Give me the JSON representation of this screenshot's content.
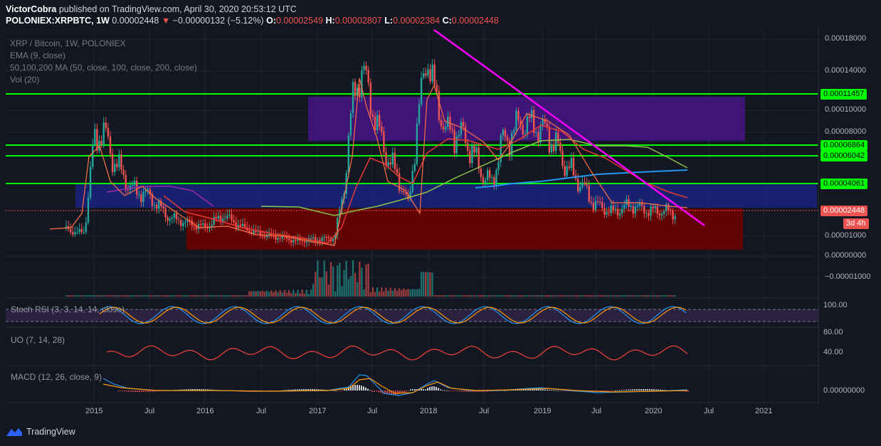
{
  "header": {
    "publisher": "VictorCobra",
    "published_text": "published on TradingView.com, April 30, 2020 20:53:12 UTC",
    "symbol": "POLONIEX:XRPBTC, 1W",
    "last": "0.00002448",
    "arrow": "▼",
    "change": "−0.00000132 (−5.12%)",
    "o_label": "O:",
    "o_value": "0.00002549",
    "h_label": "H:",
    "h_value": "0.00002807",
    "l_label": "L:",
    "l_value": "0.00002384",
    "c_label": "C:",
    "c_value": "0.00002448"
  },
  "indicators": {
    "title": "XRP / Bitcoin, 1W, POLONIEX",
    "ema": "EMA (9, close)",
    "ma": "50,100,200 MA (50, close, 100, close, 200, close)",
    "vol": "Vol (20)"
  },
  "panes": {
    "stoch": "Stoch RSI (3, 3, 14, 14, close)",
    "uo": "UO (7, 14, 28)",
    "macd": "MACD (12, 26, close, 9)"
  },
  "price_axis": [
    "0.00018000",
    "0.00014000",
    "0.00010000",
    "0.00008000",
    "0.00001000",
    "0.00000000",
    "−0.00001000"
  ],
  "level_tags": [
    "0.00011457",
    "0.00006864",
    "0.00006042",
    "0.00004061"
  ],
  "current_tag": "0.00002448",
  "countdown": "3d 4h",
  "stoch_axis": [
    "100.00"
  ],
  "uo_axis": [
    "80.00",
    "40.00"
  ],
  "macd_axis": [
    "0.00000000"
  ],
  "time_axis": [
    "2015",
    "Jul",
    "2016",
    "Jul",
    "2017",
    "Jul",
    "2018",
    "Jul",
    "2019",
    "Jul",
    "2020",
    "Jul",
    "2021"
  ],
  "footer": {
    "brand": "TradingView"
  },
  "colors": {
    "background": "#131722",
    "support_line": "#00ff00",
    "trend_line": "#ff00ff",
    "candle_up": "#26a69a",
    "candle_down": "#ef5350",
    "zone_purple": "#4a148c",
    "zone_blue": "#1a237e",
    "zone_red": "#6b0000"
  },
  "chart_data": {
    "type": "line",
    "title": "XRP / Bitcoin, 1W, POLONIEX",
    "x_range": [
      "2014-07",
      "2021-01"
    ],
    "ylabel": "",
    "ylim": [
      -1.25e-05,
      0.000188
    ],
    "horizontal_levels": [
      0.00011457,
      6.864e-05,
      6.042e-05,
      4.061e-05
    ],
    "last_price": 2.448e-05,
    "series": [
      {
        "name": "",
        "x": [
          "2014-10",
          "2014-11",
          "2014-12",
          "2015-01",
          "2015-02",
          "2015-03",
          "2015-05",
          "2015-07",
          "2015-09",
          "2015-11",
          "2016-01",
          "2016-03",
          "2016-05",
          "2016-07",
          "2016-09",
          "2016-11",
          "2017-01",
          "2017-03",
          "2017-04",
          "2017-05",
          "2017-06",
          "2017-07",
          "2017-08",
          "2017-09",
          "2017-10",
          "2017-11",
          "2017-12",
          "2018-01",
          "2018-02",
          "2018-03",
          "2018-05",
          "2018-07",
          "2018-08",
          "2018-09",
          "2018-10",
          "2018-11",
          "2018-12",
          "2019-02",
          "2019-04",
          "2019-06",
          "2019-07",
          "2019-09",
          "2019-11",
          "2020-01",
          "2020-03",
          "2020-04"
        ],
        "values": [
          1.55e-05,
          1.2e-05,
          1.35e-05,
          7.5e-05,
          8.2e-05,
          6.3e-05,
          4.2e-05,
          3.7e-05,
          2.3e-05,
          1.9e-05,
          1.6e-05,
          2.4e-05,
          1.6e-05,
          1.1e-05,
          9.5e-06,
          7.5e-06,
          8.5e-06,
          9e-06,
          4e-05,
          0.00011,
          0.000145,
          0.000105,
          7.5e-05,
          6e-05,
          4.8e-05,
          3e-05,
          9e-05,
          0.00016,
          0.00011,
          8.2e-05,
          7.8e-05,
          5.2e-05,
          4.5e-05,
          7.2e-05,
          7.8e-05,
          8.9e-05,
          8.8e-05,
          8.1e-05,
          5.8e-05,
          4.2e-05,
          3.2e-05,
          2.6e-05,
          3.1e-05,
          2.7e-05,
          2.7e-05,
          2.448e-05
        ]
      }
    ]
  }
}
